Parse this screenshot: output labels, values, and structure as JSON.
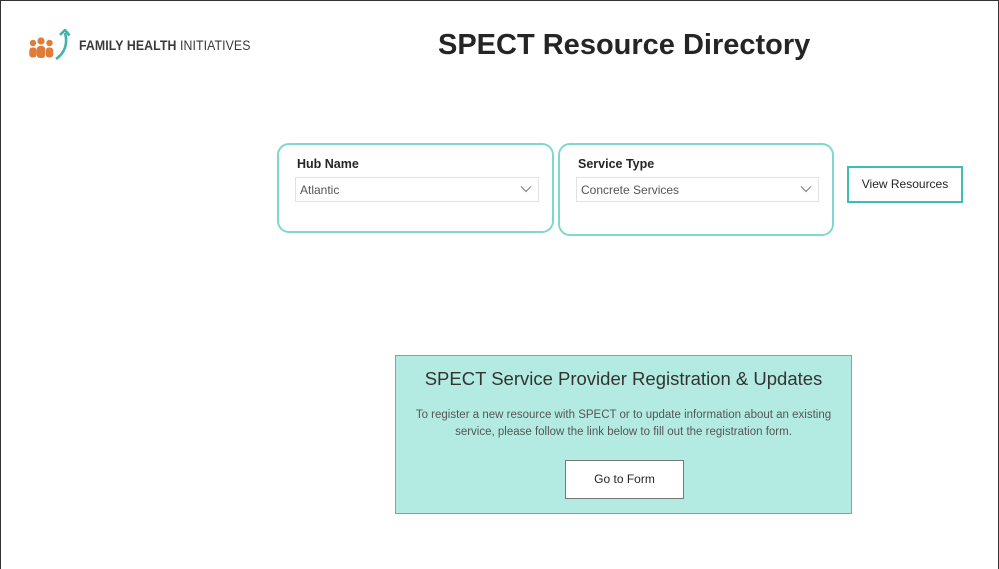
{
  "header": {
    "logo": {
      "bold_text": "FAMILY HEALTH",
      "regular_text": "INITIATIVES"
    },
    "title": "SPECT Resource Directory"
  },
  "filters": {
    "hub": {
      "label": "Hub Name",
      "selected": "Atlantic"
    },
    "service": {
      "label": "Service Type",
      "selected": "Concrete Services"
    }
  },
  "actions": {
    "view_resources_label": "View Resources"
  },
  "registration": {
    "title": "SPECT Service Provider Registration & Updates",
    "description": "To register a new resource with SPECT or to update information about an existing service, please follow the link below to fill out the registration form.",
    "button_label": "Go to Form"
  },
  "colors": {
    "slicer_border": "#7fd8cf",
    "button_border": "#3fbcb4",
    "panel_background": "#b3ebe3",
    "logo_orange": "#e07b39",
    "logo_teal": "#3fb3aa"
  }
}
